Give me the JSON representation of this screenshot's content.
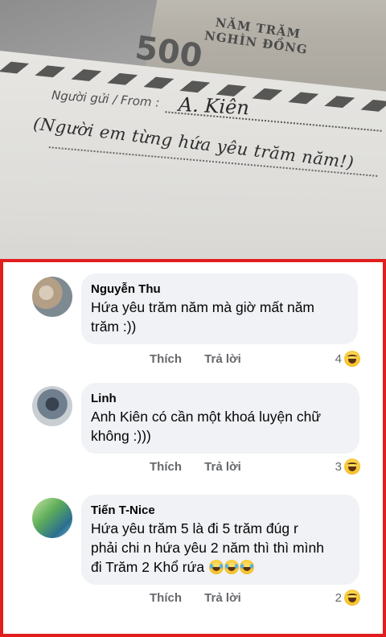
{
  "photo": {
    "banknote_big": "500",
    "banknote_line1": "NĂM TRĂM",
    "banknote_line2": "NGHÌN ĐỒNG",
    "from_label": "Người gửi / From :",
    "handwritten_name": "A. Kiên",
    "handwritten_note": "(Người em từng hứa yêu trăm năm!)"
  },
  "actions": {
    "like_label": "Thích",
    "reply_label": "Trả lời"
  },
  "comments": [
    {
      "author": "Nguyễn Thu",
      "line1": "Hứa yêu trăm năm mà giờ mất năm",
      "line2": "trăm :))",
      "reaction_count": "4",
      "reaction_icon": "haha-icon"
    },
    {
      "author": "Linh",
      "line1": "Anh Kiên có cần một khoá luyện chữ",
      "line2": "không :)))",
      "reaction_count": "3",
      "reaction_icon": "haha-icon"
    },
    {
      "author": "Tiến T-Nice",
      "line1": "Hứa yêu trăm 5 là đi 5 trăm  đúg r",
      "line2": "phải chi n hứa yêu 2 năm thì thì mình",
      "line3": "đi Trăm 2 Khổ rứa",
      "reaction_count": "2",
      "reaction_icon": "haha-icon"
    }
  ],
  "colors": {
    "highlight_border": "#e11d1d",
    "bubble": "#f0f2f5",
    "muted_text": "#65676b"
  }
}
